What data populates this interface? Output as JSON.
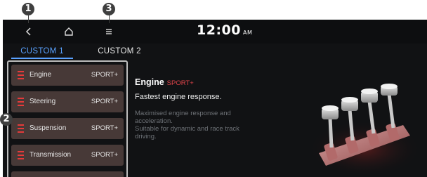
{
  "callouts": [
    "1",
    "2",
    "3"
  ],
  "topbar": {
    "back_icon": "back-arrow-icon",
    "home_icon": "home-icon",
    "menu_icon": "menu-icon",
    "time": "12:00",
    "ampm": "AM"
  },
  "tabs": [
    {
      "label": "CUSTOM 1",
      "active": true
    },
    {
      "label": "CUSTOM 2",
      "active": false
    }
  ],
  "modes": [
    {
      "label": "Engine",
      "value": "SPORT+"
    },
    {
      "label": "Steering",
      "value": "SPORT+"
    },
    {
      "label": "Suspension",
      "value": "SPORT+"
    },
    {
      "label": "Transmission",
      "value": "SPORT+"
    }
  ],
  "detail": {
    "title": "Engine",
    "mode": "SPORT+",
    "subtitle": "Fastest engine response.",
    "description_line1": "Maximised engine response and",
    "description_line2": "acceleration.",
    "description_line3": "Suitable for dynamic and race track",
    "description_line4": "driving."
  },
  "colors": {
    "accent_blue": "#5aa2ff",
    "sport_red": "#e0444a",
    "item_bg": "#473937",
    "screen_bg": "#111214"
  }
}
